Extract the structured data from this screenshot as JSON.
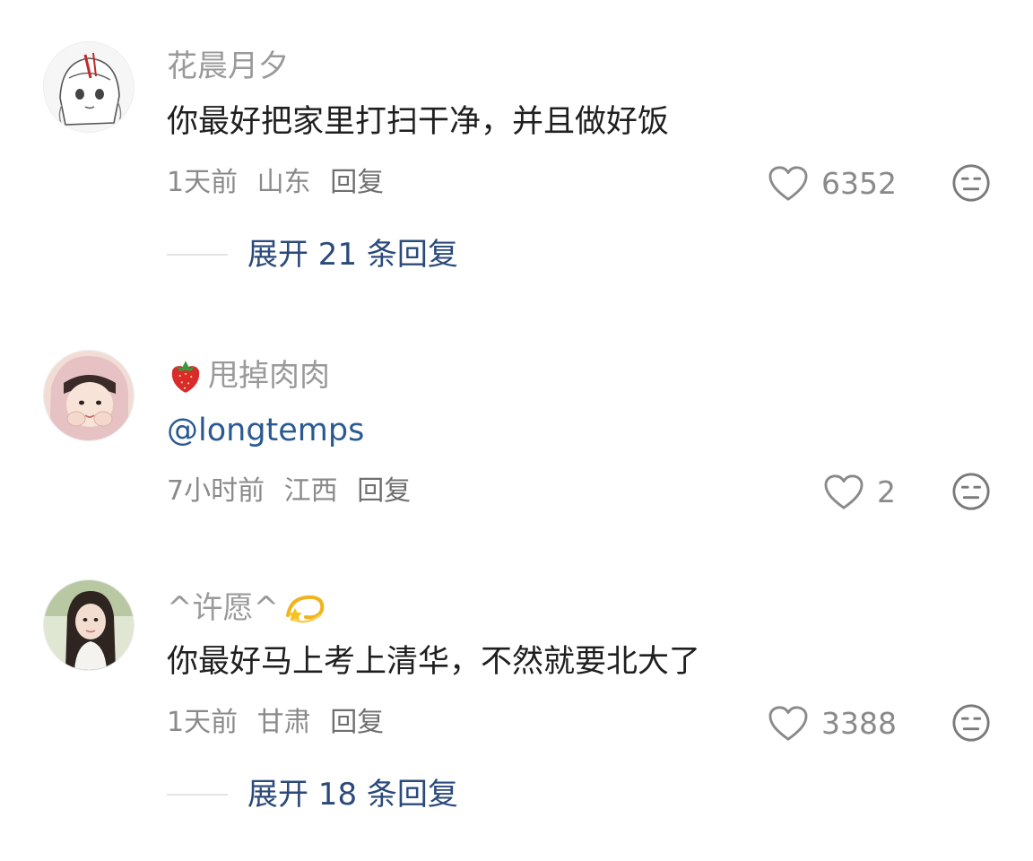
{
  "comments": [
    {
      "username": "花晨月夕",
      "text": "你最好把家里打扫干净，并且做好饭",
      "time": "1天前",
      "location": "山东",
      "reply_label": "回复",
      "likes": "6352",
      "expand_label": "展开 21 条回复"
    },
    {
      "username": "甩掉肉肉",
      "name_emoji": "strawberry-icon",
      "text": "@longtemps",
      "time": "7小时前",
      "location": "江西",
      "reply_label": "回复",
      "likes": "2"
    },
    {
      "username": "^许愿^",
      "name_emoji_after": "dizzy-star-icon",
      "text": "你最好马上考上清华，不然就要北大了",
      "time": "1天前",
      "location": "甘肃",
      "reply_label": "回复",
      "likes": "3388",
      "expand_label": "展开 18 条回复"
    }
  ],
  "colors": {
    "username": "#9a9a9a",
    "text": "#1f1f1f",
    "mention": "#2b5a93",
    "expand": "#2b4a7a",
    "meta": "#8a8a8a"
  }
}
